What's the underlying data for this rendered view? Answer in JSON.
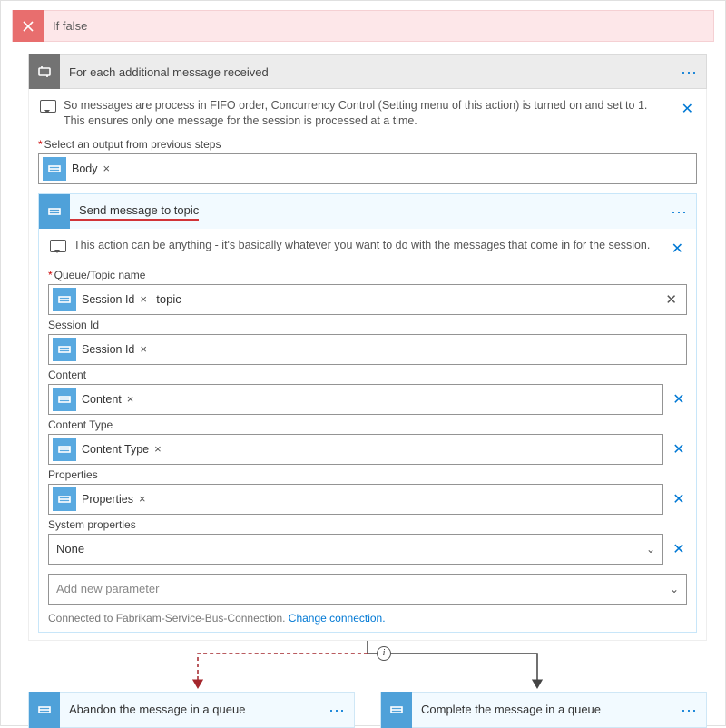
{
  "if_false": {
    "title": "If false"
  },
  "foreach": {
    "title": "For each additional message received",
    "note": "So messages are process in FIFO order, Concurrency Control (Setting menu of this action) is turned on and set to 1. This ensures only one message for the session is processed at a time.",
    "select_label": "Select an output from previous steps",
    "body_token": "Body"
  },
  "send": {
    "title": "Send message to topic",
    "note": "This action can be anything - it's basically whatever you want to do with the messages that come in for the session.",
    "fields": {
      "queue_topic": {
        "label": "Queue/Topic name",
        "token": "Session Id",
        "suffix": "-topic"
      },
      "session_id": {
        "label": "Session Id",
        "token": "Session Id"
      },
      "content": {
        "label": "Content",
        "token": "Content"
      },
      "content_type": {
        "label": "Content Type",
        "token": "Content Type"
      },
      "properties": {
        "label": "Properties",
        "token": "Properties"
      },
      "system_properties": {
        "label": "System properties",
        "value": "None"
      }
    },
    "add_param_placeholder": "Add new parameter",
    "connection_prefix": "Connected to Fabrikam-Service-Bus-Connection.  ",
    "change_connection": "Change connection."
  },
  "bottom": {
    "abandon": "Abandon the message in a queue",
    "complete": "Complete the message in a queue"
  }
}
